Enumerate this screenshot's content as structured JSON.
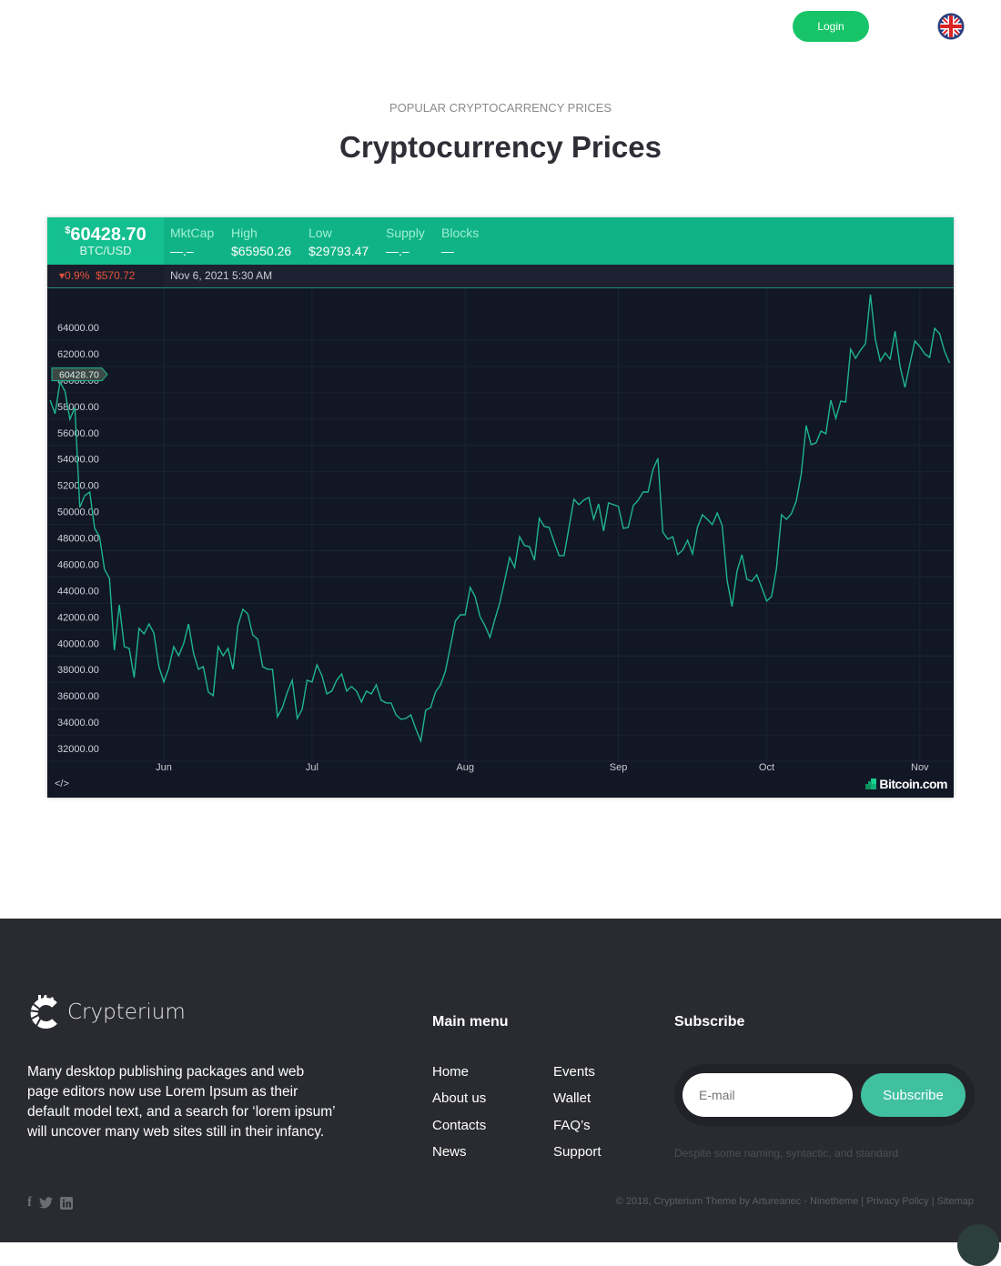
{
  "header": {
    "login_label": "Login",
    "language_icon": "uk-flag-icon"
  },
  "section": {
    "eyebrow": "POPULAR CRYPTOCARRENCY PRICES",
    "title": "Cryptocurrency Prices"
  },
  "widget": {
    "currency_symbol": "$",
    "price": "60428.70",
    "pair": "BTC/USD",
    "stats": [
      {
        "label": "MktCap",
        "value": "—.–"
      },
      {
        "label": "High",
        "value": "$65950.26"
      },
      {
        "label": "Low",
        "value": "$29793.47"
      },
      {
        "label": "Supply",
        "value": "—.–"
      },
      {
        "label": "Blocks",
        "value": "—"
      }
    ],
    "change_pct": "0.9%",
    "change_abs": "$570.72",
    "change_direction": "down",
    "datetime": "Nov 6, 2021 5:30 AM",
    "embed_label": "</>",
    "brand": "Bitcoin.com",
    "colors": {
      "line": "#1fb58f",
      "band": "#10b386",
      "down": "#e5533b",
      "background": "#111724"
    }
  },
  "chart_data": {
    "type": "line",
    "current_price_label": "60428.70",
    "y_ticks": [
      "64000.00",
      "62000.00",
      "60000.00",
      "58000.00",
      "56000.00",
      "54000.00",
      "52000.00",
      "50000.00",
      "48000.00",
      "46000.00",
      "44000.00",
      "42000.00",
      "40000.00",
      "38000.00",
      "36000.00",
      "34000.00",
      "32000.00"
    ],
    "ylim": [
      32000,
      64000
    ],
    "x_ticks": [
      {
        "label": "Jun",
        "date": "2021-06-01"
      },
      {
        "label": "Jul",
        "date": "2021-07-01"
      },
      {
        "label": "Aug",
        "date": "2021-08-01"
      },
      {
        "label": "Sep",
        "date": "2021-09-01"
      },
      {
        "label": "Oct",
        "date": "2021-10-01"
      },
      {
        "label": "Nov",
        "date": "2021-11-01"
      }
    ],
    "grid": true,
    "daily_values_by_month": [
      {
        "month": "2021-05",
        "first_day": 9,
        "values": [
          58470,
          57440,
          59850,
          59160,
          57020,
          57920,
          50320,
          51220,
          51490,
          48730,
          48100,
          45620,
          44930,
          39470,
          42920,
          39740,
          39600,
          37390,
          41130,
          40710,
          41470,
          40780,
          38220
        ]
      },
      {
        "month": "2021-06",
        "first_day": 1,
        "values": [
          37050,
          38090,
          39740,
          39050,
          39950,
          41470,
          39260,
          38020,
          38220,
          36290,
          36020,
          39740,
          39050,
          39600,
          38020,
          41340,
          42580,
          42230,
          40640,
          40300,
          38220,
          38020,
          38020,
          34420,
          35110,
          36290,
          37190,
          34290,
          34980,
          37190
        ]
      },
      {
        "month": "2021-07",
        "first_day": 1,
        "values": [
          37050,
          38360,
          37530,
          36150,
          36360,
          37190,
          37670,
          36360,
          36710,
          36360,
          35530,
          36360,
          36150,
          36840,
          35670,
          35460,
          35460,
          34560,
          34220,
          34290,
          34560,
          33500,
          32560,
          34910,
          35110,
          36290,
          36840,
          37880,
          39740,
          41680,
          42160
        ]
      },
      {
        "month": "2021-08",
        "first_day": 1,
        "values": [
          42160,
          44240,
          43550,
          42030,
          41340,
          40440,
          41820,
          43060,
          44790,
          46520,
          45760,
          48100,
          47420,
          47350,
          46310,
          49490,
          48870,
          48800,
          47690,
          46660,
          46660,
          48800,
          50940,
          50530,
          50870,
          51080,
          49420,
          50590,
          48520,
          50670,
          50530
        ]
      },
      {
        "month": "2021-09",
        "first_day": 1,
        "values": [
          50390,
          48730,
          48800,
          50460,
          50870,
          51490,
          51490,
          53220,
          54050,
          48450,
          47900,
          48100,
          46730,
          47070,
          47830,
          46790,
          48800,
          49760,
          49420,
          49010,
          49900,
          48940,
          44790,
          42790,
          45480,
          46730,
          44860,
          44720,
          45200,
          44240
        ]
      },
      {
        "month": "2021-10",
        "first_day": 1,
        "values": [
          43200,
          43550,
          45690,
          49760,
          49420,
          49830,
          50800,
          52870,
          56540,
          55090,
          55230,
          56120,
          55920,
          58470,
          57090,
          58400,
          58330,
          62340,
          61650,
          62270,
          62760,
          66490,
          63100,
          61440,
          62060,
          61580,
          63720,
          61030,
          59440,
          61240,
          62960
        ]
      },
      {
        "month": "2021-11",
        "first_day": 1,
        "values": [
          62550,
          61990,
          61720,
          63930,
          63520,
          62200,
          61300
        ]
      }
    ]
  },
  "footer": {
    "brand": "Crypterium",
    "about": "Many desktop publishing packages and web page editors now use Lorem Ipsum as their default model text, and a search for ‘lorem ipsum’ will uncover many web sites still in their infancy.",
    "menu_title": "Main menu",
    "menu": [
      "Home",
      "About us",
      "Contacts",
      "News",
      "Events",
      "Wallet",
      "FAQ’s",
      "Support"
    ],
    "subscribe_title": "Subscribe",
    "email_placeholder": "E-mail",
    "subscribe_label": "Subscribe",
    "subscribe_note": "Despite some naming, syntactic, and standard",
    "social": [
      "facebook-icon",
      "twitter-icon",
      "linkedin-icon"
    ],
    "copyright": "© 2018, Crypterium Theme by Artureanec - Ninetheme | Privacy Policy | Sitemap"
  }
}
